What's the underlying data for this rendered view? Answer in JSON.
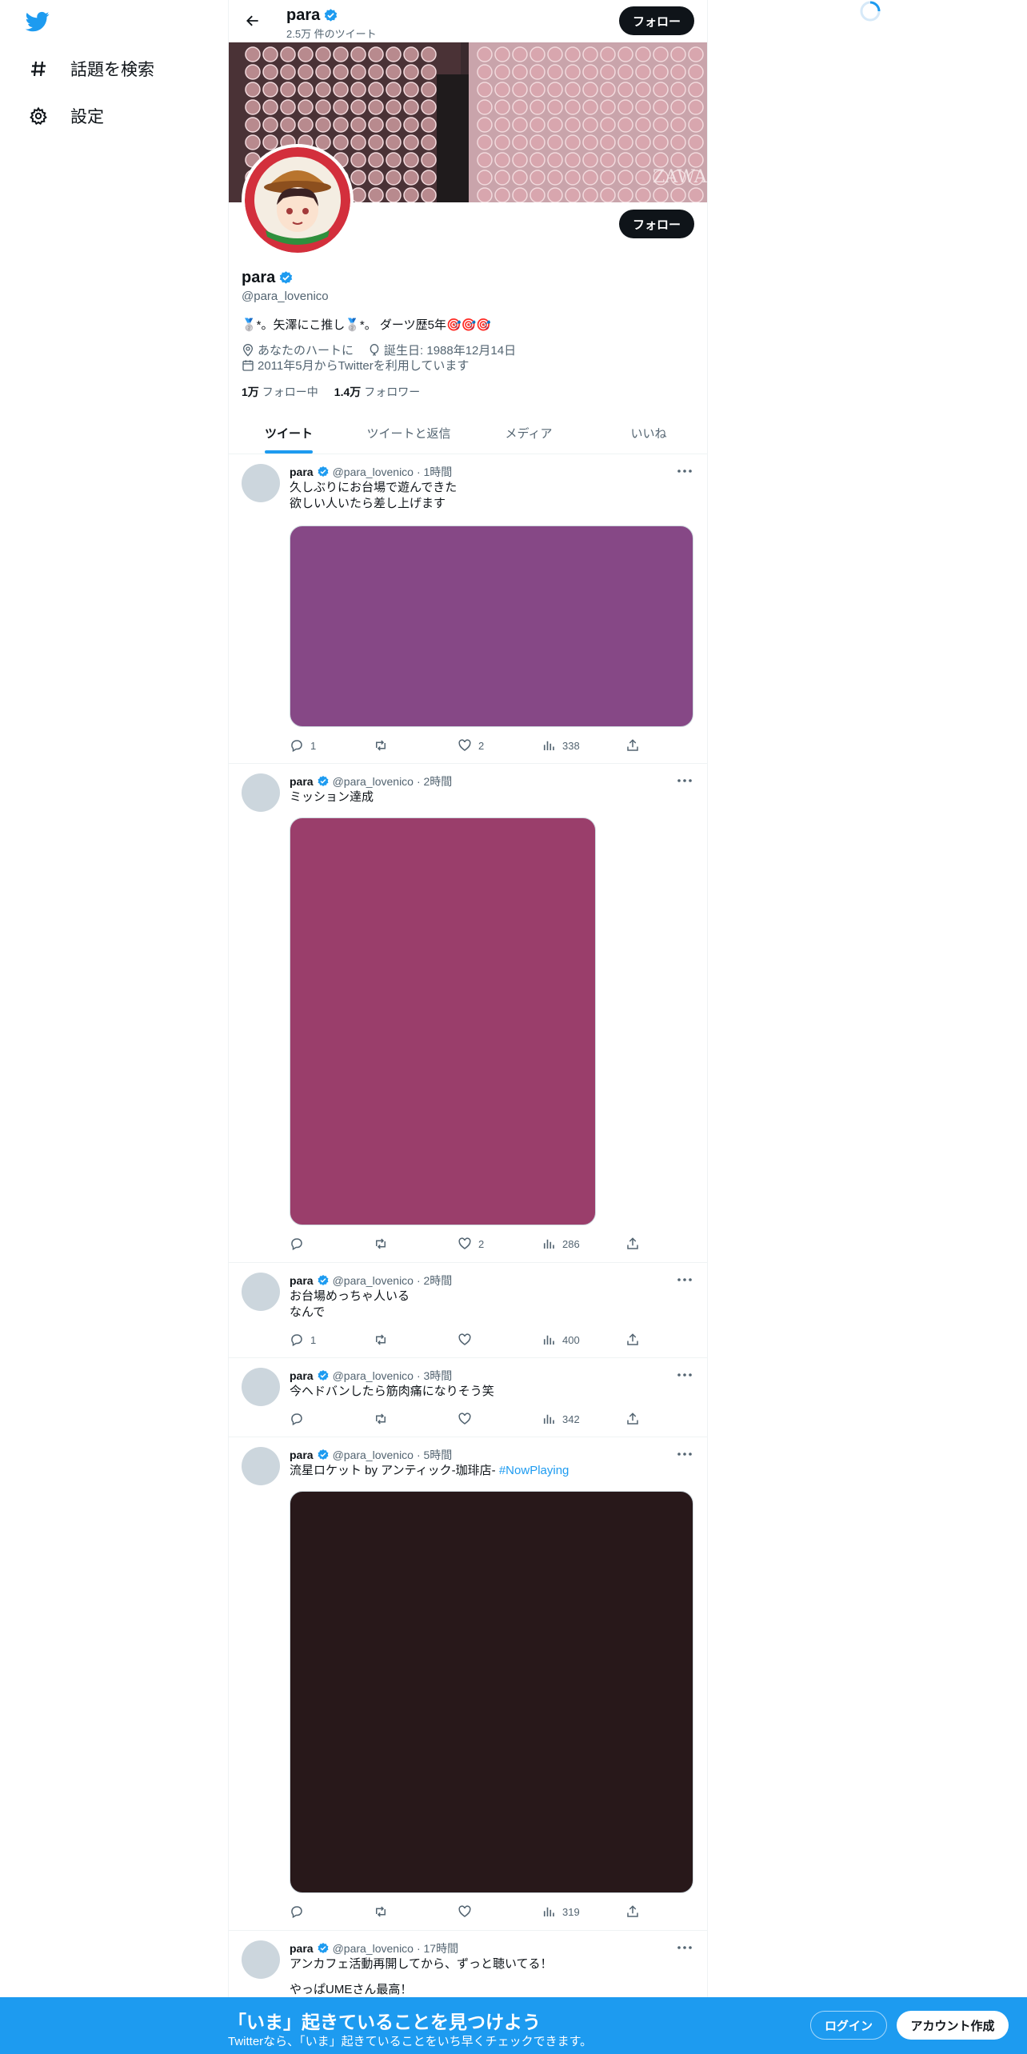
{
  "sidebar": {
    "items": [
      {
        "label": "話題を検索",
        "icon": "hashtag-icon"
      },
      {
        "label": "設定",
        "icon": "gear-icon"
      }
    ]
  },
  "header": {
    "name": "para",
    "tweet_count": "2.5万 件のツイート",
    "follow_label": "フォロー"
  },
  "profile": {
    "name": "para",
    "handle": "@para_lovenico",
    "bio": "🥈*。矢澤にこ推し🥈*。 ダーツ歴5年🎯🎯🎯",
    "location": "あなたのハートに",
    "birthday": "誕生日: 1988年12月14日",
    "joined": "2011年5月からTwitterを利用しています",
    "following_count": "1万",
    "following_label": "フォロー中",
    "followers_count": "1.4万",
    "followers_label": "フォロワー",
    "follow_label": "フォロー"
  },
  "tabs": [
    {
      "label": "ツイート",
      "active": true
    },
    {
      "label": "ツイートと返信",
      "active": false
    },
    {
      "label": "メディア",
      "active": false
    },
    {
      "label": "いいね",
      "active": false
    }
  ],
  "tweets": [
    {
      "name": "para",
      "handle": "@para_lovenico",
      "time": "· 1時間",
      "line1": "久しぶりにお台場で遊んできた",
      "line2": "欲しい人いたら差し上げます",
      "media_color": "#864886",
      "replies": "1",
      "retweets": "",
      "likes": "2",
      "views": "338"
    },
    {
      "name": "para",
      "handle": "@para_lovenico",
      "time": "· 2時間",
      "line1": "ミッション達成",
      "line2": "",
      "media_color": "#9a3e6b",
      "replies": "",
      "retweets": "",
      "likes": "2",
      "views": "286"
    },
    {
      "name": "para",
      "handle": "@para_lovenico",
      "time": "· 2時間",
      "line1": "お台場めっちゃ人いる",
      "line2": "なんで",
      "replies": "1",
      "retweets": "",
      "likes": "",
      "views": "400"
    },
    {
      "name": "para",
      "handle": "@para_lovenico",
      "time": "· 3時間",
      "line1": "今ヘドバンしたら筋肉痛になりそう笑",
      "line2": "",
      "replies": "",
      "retweets": "",
      "likes": "",
      "views": "342"
    },
    {
      "name": "para",
      "handle": "@para_lovenico",
      "time": "· 5時間",
      "line1": "流星ロケット by アンティック-珈琲店- ",
      "hashtag": "#NowPlaying",
      "media_color": "#28181a",
      "replies": "",
      "retweets": "",
      "likes": "",
      "views": "319"
    },
    {
      "name": "para",
      "handle": "@para_lovenico",
      "time": "· 17時間",
      "line1": "アンカフェ活動再開してから、ずっと聴いてる！",
      "line2": "やっぱUMEさん最高！"
    }
  ],
  "bottom": {
    "title": "「いま」起きていることを見つけよう",
    "subtitle": "Twitterなら、「いま」起きていることをいち早くチェックできます。",
    "login": "ログイン",
    "signup": "アカウント作成"
  },
  "colors": {
    "brand": "#1d9bf0",
    "text": "#0f1419",
    "muted": "#536471"
  }
}
